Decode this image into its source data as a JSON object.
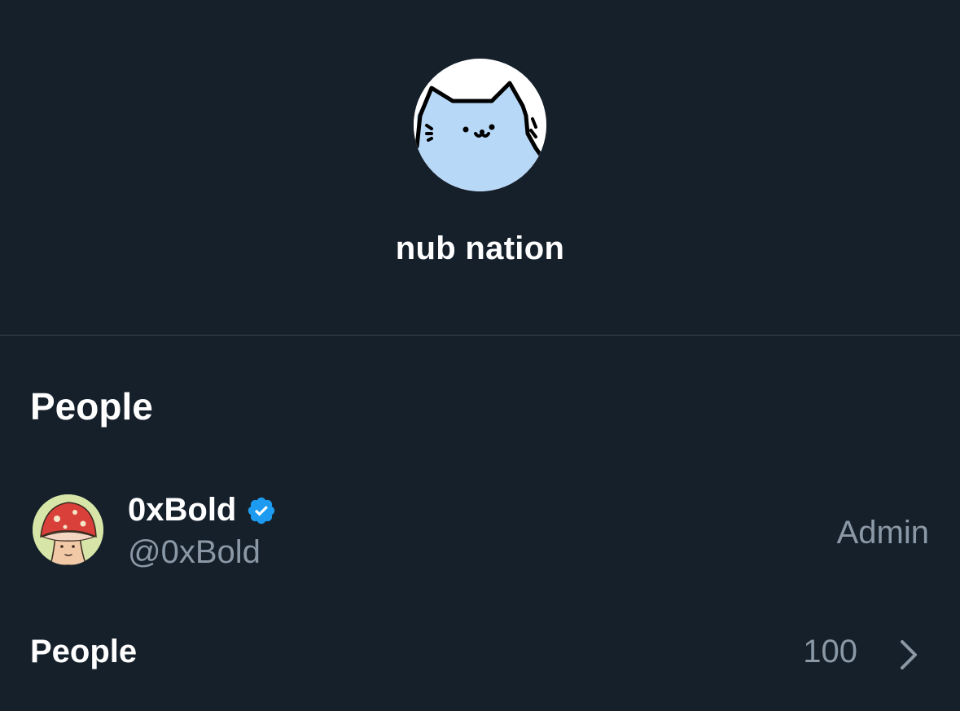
{
  "group": {
    "name": "nub nation",
    "avatar_icon": "cat-avatar-icon"
  },
  "people_section": {
    "heading": "People",
    "members": [
      {
        "display_name": "0xBold",
        "handle": "@0xBold",
        "role": "Admin",
        "verified": true,
        "avatar_icon": "mushroom-avatar-icon"
      }
    ]
  },
  "people_count_row": {
    "label": "People",
    "count": "100",
    "chevron_icon": "chevron-right-icon"
  },
  "colors": {
    "background": "#15202b",
    "divider": "#38444d",
    "secondary_text": "#8b98a5",
    "verified_blue": "#1d9bf0",
    "cat_blue": "#b8d8f8"
  }
}
